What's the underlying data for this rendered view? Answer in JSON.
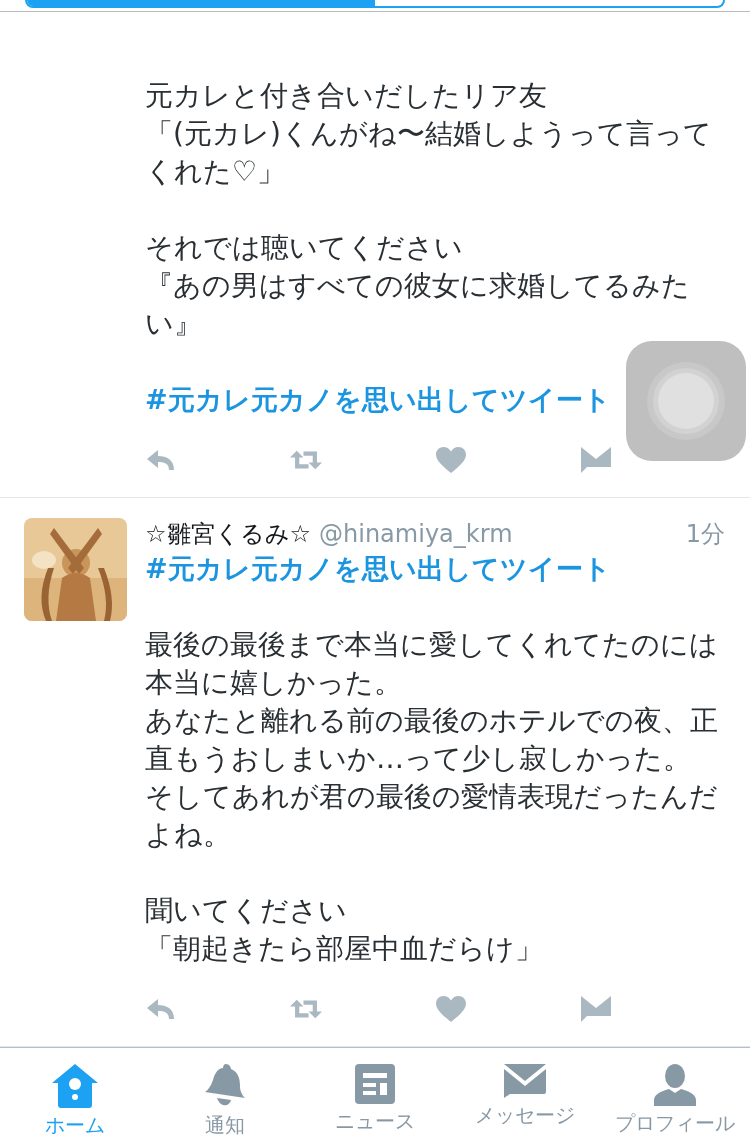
{
  "top_bar": {
    "level": 0.5
  },
  "tweets": [
    {
      "blocks": [
        {
          "kind": "text",
          "lines": [
            "元カレと付き合いだしたリア友",
            "「(元カレ)くんがね〜結婚しようって言ってくれた♡」"
          ]
        },
        {
          "kind": "text",
          "lines": [
            "それでは聴いてください",
            "『あの男はすべての彼女に求婚してるみたい』"
          ]
        },
        {
          "kind": "hashtag",
          "text": "#元カレ元カノを思い出してツイート"
        }
      ]
    },
    {
      "author": {
        "name": "☆雛宮くるみ☆",
        "handle": "@hinamiya_krm",
        "time": "1分"
      },
      "blocks": [
        {
          "kind": "hashtag",
          "text": "#元カレ元カノを思い出してツイート"
        },
        {
          "kind": "text",
          "lines": [
            "最後の最後まで本当に愛してくれてたのには本当に嬉しかった。",
            "あなたと離れる前の最後のホテルでの夜、正直もうおしまいか…って少し寂しかった。",
            "そしてあれが君の最後の愛情表現だったんだよね。"
          ]
        },
        {
          "kind": "text",
          "lines": [
            "聞いてください",
            "「朝起きたら部屋中血だらけ」"
          ]
        }
      ]
    }
  ],
  "tab_bar": [
    {
      "label": "ホーム",
      "kind": "home",
      "selected": true
    },
    {
      "label": "通知",
      "kind": "bell",
      "selected": false
    },
    {
      "label": "ニュース",
      "kind": "news",
      "selected": false
    },
    {
      "label": "メッセージ",
      "kind": "mail",
      "selected": false
    },
    {
      "label": "プロフィール",
      "kind": "profile",
      "selected": false
    }
  ]
}
